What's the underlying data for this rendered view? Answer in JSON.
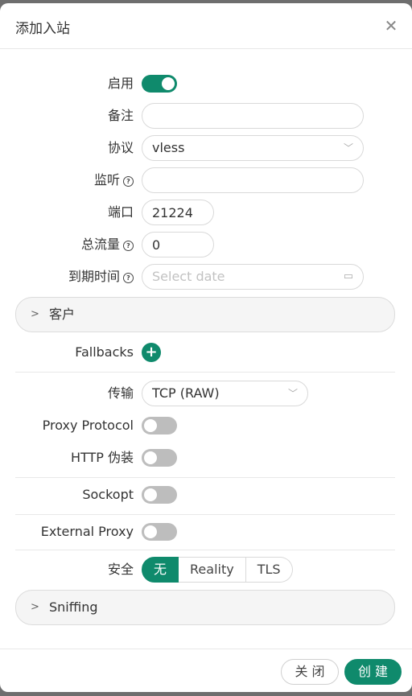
{
  "modal": {
    "title": "添加入站"
  },
  "form": {
    "enable": {
      "label": "启用",
      "on": true
    },
    "remark": {
      "label": "备注",
      "value": ""
    },
    "protocol": {
      "label": "协议",
      "value": "vless"
    },
    "listen": {
      "label": "监听",
      "value": ""
    },
    "port": {
      "label": "端口",
      "value": "21224"
    },
    "total_traffic": {
      "label": "总流量",
      "value": "0"
    },
    "expiry": {
      "label": "到期时间",
      "placeholder": "Select date"
    },
    "clients": {
      "title": "客户"
    },
    "fallbacks": {
      "label": "Fallbacks"
    },
    "transport": {
      "label": "传输",
      "value": "TCP (RAW)"
    },
    "proxy_protocol": {
      "label": "Proxy Protocol",
      "on": false
    },
    "http_camouflage": {
      "label": "HTTP 伪装",
      "on": false
    },
    "sockopt": {
      "label": "Sockopt",
      "on": false
    },
    "external_proxy": {
      "label": "External Proxy",
      "on": false
    },
    "security": {
      "label": "安全",
      "options": [
        "无",
        "Reality",
        "TLS"
      ],
      "selected": "无"
    },
    "sniffing": {
      "title": "Sniffing"
    }
  },
  "footer": {
    "cancel_label": "关 闭",
    "create_label": "创 建"
  },
  "colors": {
    "accent": "#0f8a6c",
    "toggle_off": "#bdbdbd"
  }
}
